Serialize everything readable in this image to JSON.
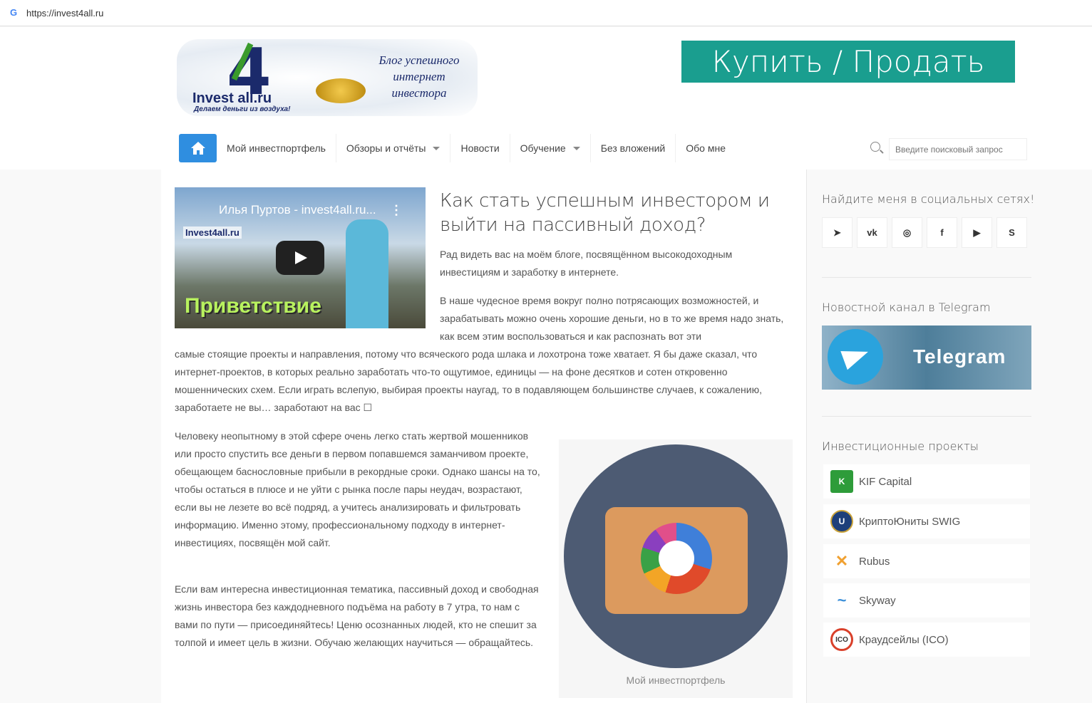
{
  "browser": {
    "icon": "google-g-icon",
    "url": "https://invest4all.ru"
  },
  "logo": {
    "digit": "4",
    "name": "Invest  all.ru",
    "tagline": "Делаем деньги из воздуха!",
    "blog": "Блог успешного интернет инвестора"
  },
  "banner": {
    "label": "Купить / Продать",
    "color": "#1a9e8f"
  },
  "nav": {
    "home_icon": "home-icon",
    "items": [
      {
        "label": "Мой инвестпортфель"
      },
      {
        "label": "Обзоры и отчёты",
        "dropdown": true
      },
      {
        "label": "Новости"
      },
      {
        "label": "Обучение",
        "dropdown": true
      },
      {
        "label": "Без вложений"
      },
      {
        "label": "Обо мне"
      }
    ],
    "search_placeholder": "Введите поисковый запрос"
  },
  "video": {
    "title": "Илья Пуртов - invest4all.ru...",
    "overlay": "Приветствие",
    "logo": "Invest4all.ru"
  },
  "article": {
    "title": "Как стать успешным инвестором и выйти на пассивный доход?",
    "p1": "Рад видеть вас на моём блоге, посвящённом высокодоходным инвестициям и заработку в интернете.",
    "p2": "В наше чудесное время вокруг полно потрясающих возможностей, и зарабатывать можно очень хорошие деньги, но в то же время надо знать, как всем этим воспользоваться и как распознать вот эти",
    "p2b": "самые стоящие проекты и направления, потому что всяческого рода шлака и лохотрона тоже хватает. Я бы даже сказал, что интернет-проектов, в которых реально заработать что-то ощутимое, единицы — на фоне десятков и сотен откровенно мошеннических схем. Если играть вслепую, выбирая проекты наугад, то в подавляющем большинстве случаев, к сожалению, заработаете не вы… заработают на вас ☐",
    "p3": "Человеку неопытному в этой сфере очень легко стать жертвой мошенников или просто спустить все деньги в первом попавшемся заманчивом проекте, обещающем баснословные прибыли в рекордные сроки. Однако шансы на то, чтобы остаться в плюсе и не уйти с рынка после пары неудач, возрастают, если вы не лезете во всё подряд, а учитесь анализировать и фильтровать информацию. Именно этому, профессиональному подходу в интернет-инвестициях, посвящён мой сайт.",
    "p4": "Если вам интересна инвестиционная тематика, пассивный доход и свободная жизнь инвестора без каждодневного подъёма на работу в 7 утра, то нам с вами по пути — присоединяйтесь! Ценю осознанных людей, кто не спешит за толпой и имеет цель в жизни. Обучаю желающих научиться — обращайтесь.",
    "figure_caption": "Мой инвестпортфель"
  },
  "sidebar": {
    "social_title": "Найдите меня в социальных сетях!",
    "social": [
      {
        "icon": "telegram-icon",
        "g": "➤"
      },
      {
        "icon": "vk-icon",
        "g": "vk"
      },
      {
        "icon": "instagram-icon",
        "g": "◎"
      },
      {
        "icon": "facebook-icon",
        "g": "f"
      },
      {
        "icon": "youtube-icon",
        "g": "▶"
      },
      {
        "icon": "skype-icon",
        "g": "S"
      }
    ],
    "telegram_title": "Новостной канал в Telegram",
    "telegram_banner": "Telegram",
    "projects_title": "Инвестиционные проекты",
    "projects": [
      {
        "label": "KIF Capital",
        "badge": "K",
        "color": "#2e9c3a"
      },
      {
        "label": "КриптоЮниты SWIG",
        "badge": "U",
        "color": "#1e3f7a"
      },
      {
        "label": "Rubus",
        "badge": "✕",
        "color": "#f0a030"
      },
      {
        "label": "Skyway",
        "badge": "~",
        "color": "#3b8fd9"
      },
      {
        "label": "Краудсейлы (ICO)",
        "badge": "ICO",
        "color": "#d9402a"
      }
    ]
  }
}
